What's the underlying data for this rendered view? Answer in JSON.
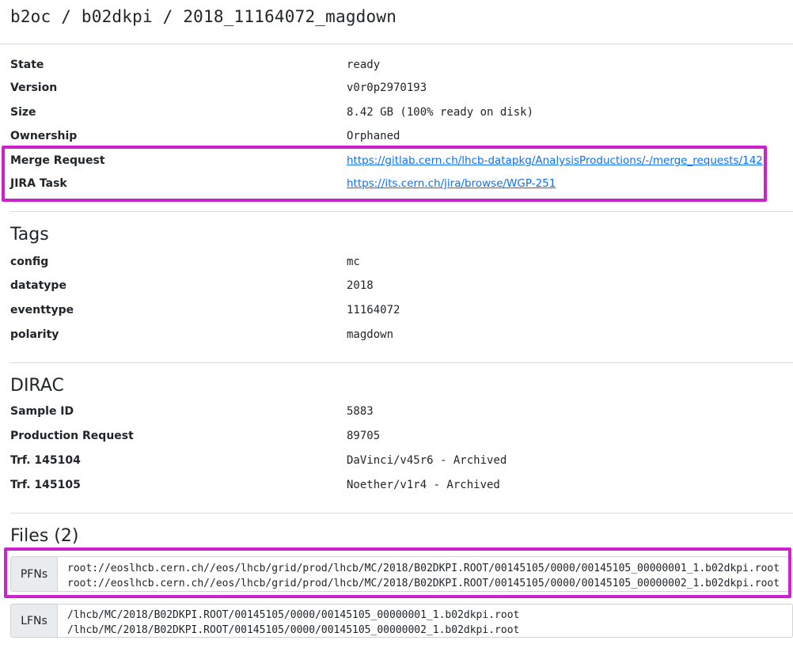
{
  "breadcrumb": {
    "parts": [
      "b2oc",
      "b02dkpi",
      "2018_11164072_magdown"
    ],
    "separator": "/"
  },
  "info": [
    {
      "key": "State",
      "value": "ready",
      "type": "mono"
    },
    {
      "key": "Version",
      "value": "v0r0p2970193",
      "type": "mono"
    },
    {
      "key": "Size",
      "value": "8.42 GB (100% ready on disk)",
      "type": "mono"
    },
    {
      "key": "Ownership",
      "value": "Orphaned",
      "type": "mono"
    },
    {
      "key": "Merge Request",
      "value": "https://gitlab.cern.ch/lhcb-datapkg/AnalysisProductions/-/merge_requests/142",
      "type": "link"
    },
    {
      "key": "JIRA Task",
      "value": "https://its.cern.ch/jira/browse/WGP-251",
      "type": "link"
    }
  ],
  "tags": {
    "title": "Tags",
    "rows": [
      {
        "key": "config",
        "value": "mc"
      },
      {
        "key": "datatype",
        "value": "2018"
      },
      {
        "key": "eventtype",
        "value": "11164072"
      },
      {
        "key": "polarity",
        "value": "magdown"
      }
    ]
  },
  "dirac": {
    "title": "DIRAC",
    "rows": [
      {
        "key": "Sample ID",
        "value": "5883"
      },
      {
        "key": "Production Request",
        "value": "89705"
      },
      {
        "key": "Trf. 145104",
        "value": "DaVinci/v45r6 - Archived"
      },
      {
        "key": "Trf. 145105",
        "value": "Noether/v1r4 - Archived"
      }
    ]
  },
  "files": {
    "title": "Files (2)",
    "pfns_label": "PFNs",
    "pfns": [
      "root://eoslhcb.cern.ch//eos/lhcb/grid/prod/lhcb/MC/2018/B02DKPI.ROOT/00145105/0000/00145105_00000001_1.b02dkpi.root",
      "root://eoslhcb.cern.ch//eos/lhcb/grid/prod/lhcb/MC/2018/B02DKPI.ROOT/00145105/0000/00145105_00000002_1.b02dkpi.root"
    ],
    "lfns_label": "LFNs",
    "lfns": [
      "/lhcb/MC/2018/B02DKPI.ROOT/00145105/0000/00145105_00000001_1.b02dkpi.root",
      "/lhcb/MC/2018/B02DKPI.ROOT/00145105/0000/00145105_00000002_1.b02dkpi.root"
    ]
  },
  "colors": {
    "highlight": "#cc22cc",
    "link": "#0d6efd",
    "text": "#212529"
  }
}
